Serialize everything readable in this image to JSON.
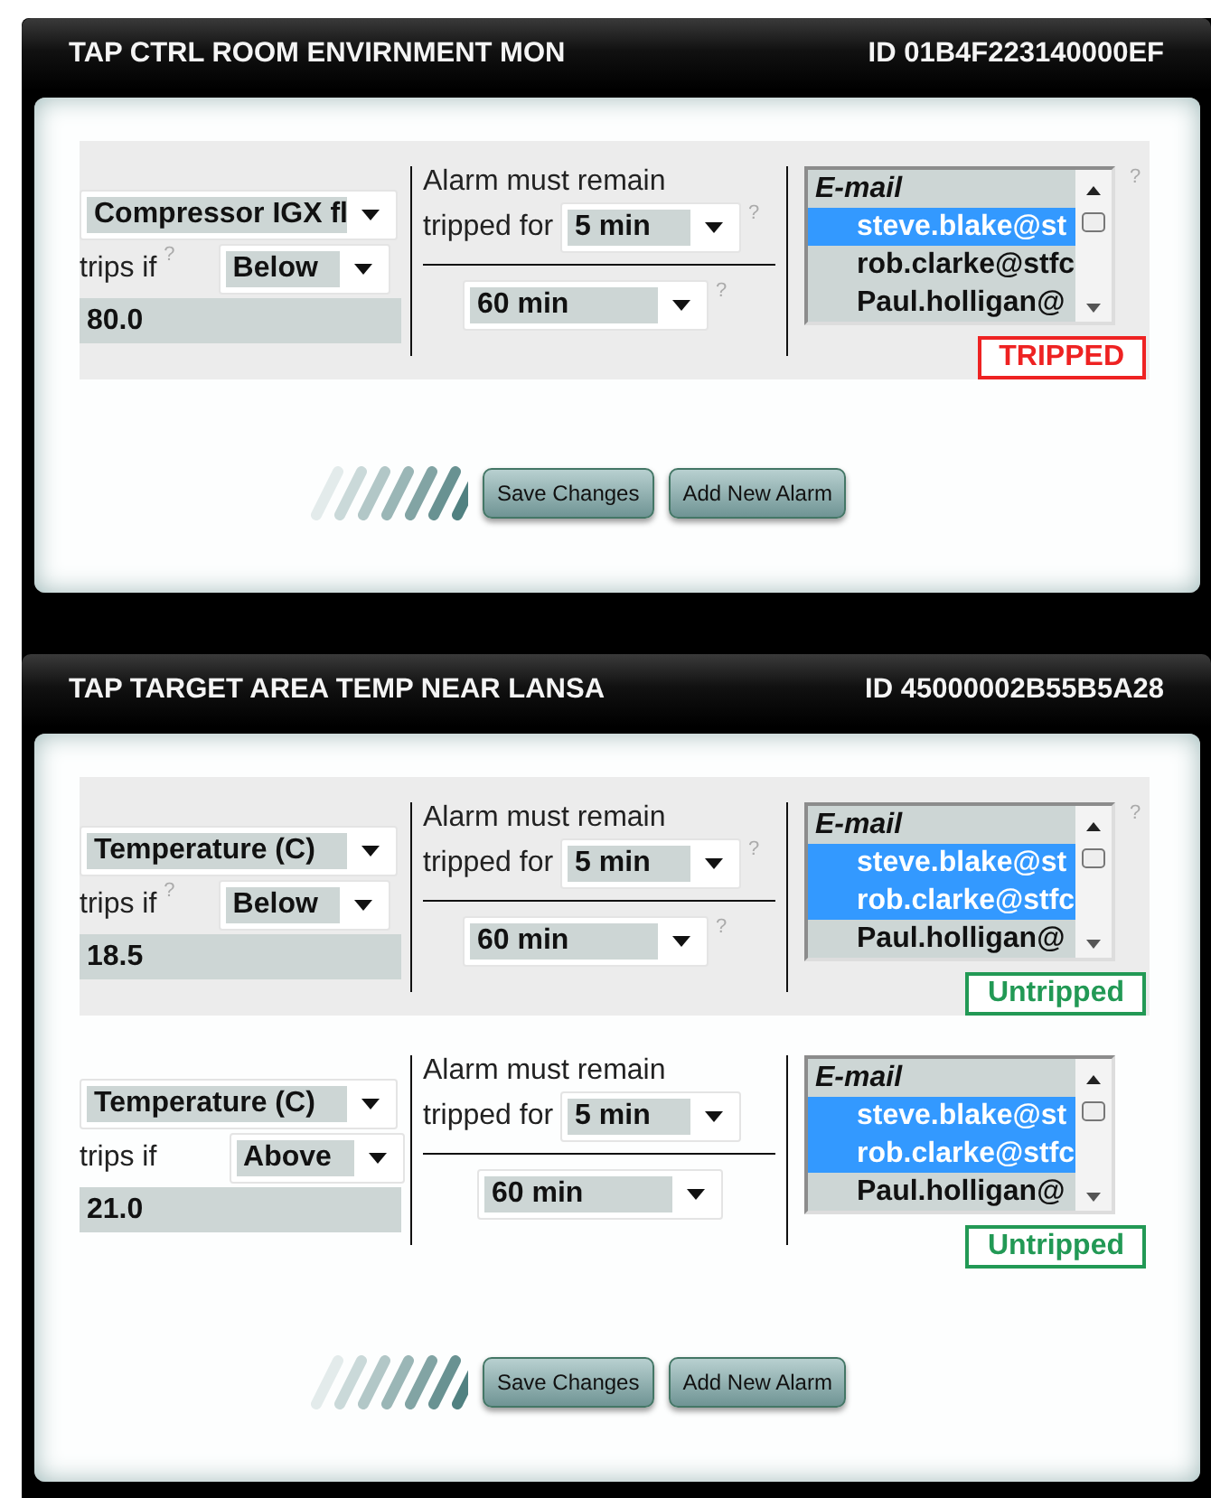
{
  "panels": [
    {
      "title": "TAP CTRL ROOM ENVIRNMENT MON",
      "id": "ID 01B4F223140000EF",
      "alarms": [
        {
          "highlighted": true,
          "sensor": "Compressor IGX fl",
          "trips_label": "trips if",
          "trips_help": "?",
          "condition": "Below",
          "threshold": "80.0",
          "remain_label": "Alarm must remain",
          "tripped_for_label": "tripped for",
          "duration": "5 min",
          "duration_help": "?",
          "window": "60 min",
          "window_help": "?",
          "email_header": "E-mail",
          "list_help": "?",
          "recipients": [
            {
              "address": "steve.blake@st",
              "selected": true
            },
            {
              "address": "rob.clarke@stfc",
              "selected": false
            },
            {
              "address": "Paul.holligan@",
              "selected": false
            }
          ],
          "status": {
            "label": "TRIPPED",
            "kind": "tripped"
          }
        }
      ],
      "buttons": [
        "Save Changes",
        "Add New Alarm"
      ]
    },
    {
      "title": "TAP TARGET AREA TEMP NEAR LANSA",
      "id": "ID 45000002B55B5A28",
      "alarms": [
        {
          "highlighted": true,
          "sensor": "Temperature (C)",
          "trips_label": "trips if",
          "trips_help": "?",
          "condition": "Below",
          "threshold": "18.5",
          "remain_label": "Alarm must remain",
          "tripped_for_label": "tripped for",
          "duration": "5 min",
          "duration_help": "?",
          "window": "60 min",
          "window_help": "?",
          "email_header": "E-mail",
          "list_help": "?",
          "recipients": [
            {
              "address": "steve.blake@st",
              "selected": true
            },
            {
              "address": "rob.clarke@stfc",
              "selected": true
            },
            {
              "address": "Paul.holligan@",
              "selected": false
            }
          ],
          "status": {
            "label": "Untripped",
            "kind": "untripped"
          }
        },
        {
          "highlighted": false,
          "sensor": "Temperature (C)",
          "trips_label": "trips if",
          "condition": "Above",
          "threshold": "21.0",
          "remain_label": "Alarm must remain",
          "tripped_for_label": "tripped for",
          "duration": "5 min",
          "window": "60 min",
          "email_header": "E-mail",
          "recipients": [
            {
              "address": "steve.blake@st",
              "selected": true
            },
            {
              "address": "rob.clarke@stfc",
              "selected": true
            },
            {
              "address": "Paul.holligan@",
              "selected": false
            }
          ],
          "status": {
            "label": "Untripped",
            "kind": "untripped"
          }
        }
      ],
      "buttons": [
        "Save Changes",
        "Add New Alarm"
      ]
    }
  ]
}
